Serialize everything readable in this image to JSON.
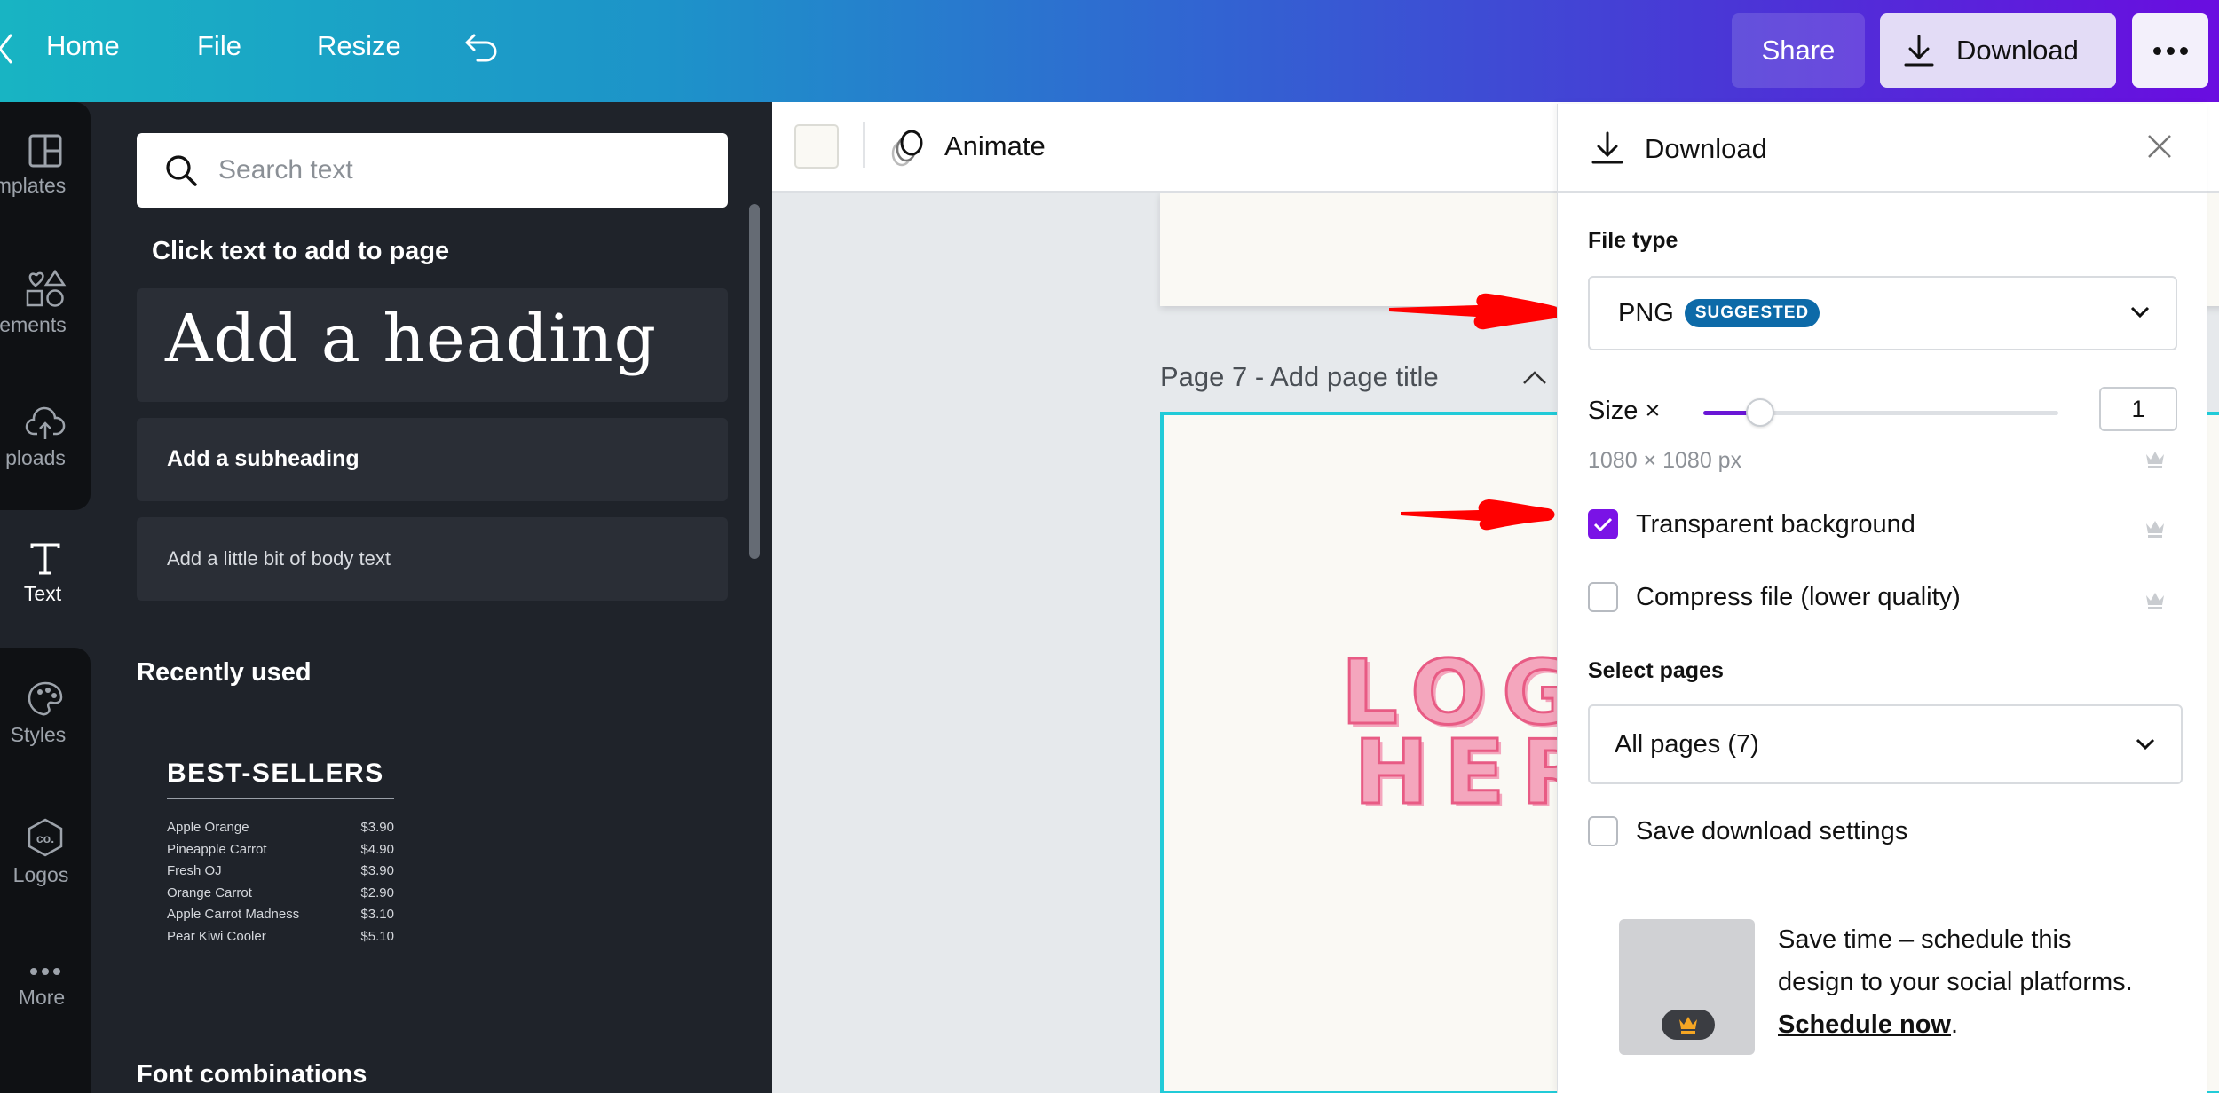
{
  "topbar": {
    "nav": {
      "home": "Home",
      "file": "File",
      "resize": "Resize"
    },
    "share_label": "Share",
    "download_label": "Download",
    "more_icon": "more-horizontal-icon"
  },
  "rail": {
    "items": [
      {
        "label": "Templates",
        "visible_label": "mplates",
        "icon": "templates-icon"
      },
      {
        "label": "Elements",
        "visible_label": "ements",
        "icon": "elements-icon"
      },
      {
        "label": "Uploads",
        "visible_label": "ploads",
        "icon": "upload-cloud-icon"
      },
      {
        "label": "Text",
        "visible_label": "Text",
        "icon": "text-icon",
        "active": true
      },
      {
        "label": "Styles",
        "visible_label": "Styles",
        "icon": "palette-icon"
      },
      {
        "label": "Logos",
        "visible_label": "Logos",
        "icon": "logo-hexagon-icon"
      },
      {
        "label": "More",
        "visible_label": "More",
        "icon": "more-icon"
      }
    ]
  },
  "panel": {
    "search_placeholder": "Search text",
    "click_to_add": "Click text to add to page",
    "heading_sample": "Add a heading",
    "subheading_sample": "Add a subheading",
    "body_sample": "Add a little bit of body text",
    "recently_used": "Recently used",
    "font_combinations": "Font combinations",
    "recent_template": {
      "title": "BEST-SELLERS",
      "items": [
        {
          "name": "Apple Orange",
          "price": "$3.90"
        },
        {
          "name": "Pineapple Carrot",
          "price": "$4.90"
        },
        {
          "name": "Fresh OJ",
          "price": "$3.90"
        },
        {
          "name": "Orange Carrot",
          "price": "$2.90"
        },
        {
          "name": "Apple Carrot Madness",
          "price": "$3.10"
        },
        {
          "name": "Pear Kiwi Cooler",
          "price": "$5.10"
        }
      ]
    }
  },
  "toolbar": {
    "swatch_color": "#faf9f4",
    "animate_label": "Animate"
  },
  "canvas": {
    "page_title": "Page 7 - Add page title",
    "logo_line1": "LOGO",
    "logo_line2": "HERE",
    "selection_color": "#21cbd8"
  },
  "download_panel": {
    "title": "Download",
    "file_type_label": "File type",
    "file_type_value": "PNG",
    "file_type_badge": "SUGGESTED",
    "size_label": "Size ×",
    "size_value": "1",
    "size_slider_fraction": 0.16,
    "dimensions": "1080 × 1080 px",
    "transparent_bg_label": "Transparent background",
    "transparent_bg_checked": true,
    "compress_label": "Compress file (lower quality)",
    "compress_checked": false,
    "select_pages_label": "Select pages",
    "select_pages_value": "All pages (7)",
    "save_settings_label": "Save download settings",
    "save_settings_checked": false,
    "promo_text": "Save time – schedule this design to your social platforms.",
    "promo_link": "Schedule now",
    "promo_suffix": "."
  },
  "colors": {
    "accent_purple": "#7a13e6",
    "badge_blue": "#0d6aa8",
    "annotation_red": "#ff0000",
    "logo_pink": "#e85b84"
  }
}
